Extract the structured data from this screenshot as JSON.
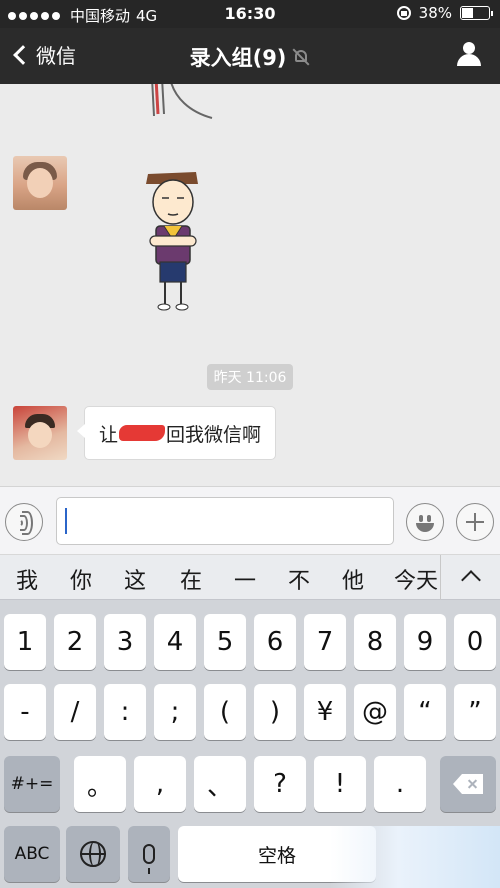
{
  "status_bar": {
    "carrier": "中国移动",
    "network": "4G",
    "time": "16:30",
    "battery": "38%",
    "battery_level": 0.38
  },
  "nav": {
    "back_label": "微信",
    "title": "录入组(9)"
  },
  "chat": {
    "timestamp": "昨天 11:06",
    "messages": [
      {
        "type": "sticker"
      },
      {
        "type": "text",
        "text_before": "让",
        "text_after": "回我微信啊"
      }
    ]
  },
  "input": {
    "value": ""
  },
  "candidates": [
    "我",
    "你",
    "这",
    "在",
    "一",
    "不",
    "他",
    "今天"
  ],
  "keyboard": {
    "row1": [
      "1",
      "2",
      "3",
      "4",
      "5",
      "6",
      "7",
      "8",
      "9",
      "0"
    ],
    "row2": [
      "-",
      "/",
      ":",
      ";",
      "(",
      ")",
      "¥",
      "@",
      "“",
      "”"
    ],
    "row3_left": "#+=",
    "row3_keys": [
      "。",
      ",",
      "、",
      "?",
      "!",
      "."
    ],
    "row4": {
      "abc": "ABC",
      "space": "空格"
    }
  },
  "colors": {
    "nav_bg": "#2b2b2b",
    "chat_bg": "#ebebeb",
    "keyboard_bg": "#d1d4d9",
    "caret": "#2b65c9"
  }
}
